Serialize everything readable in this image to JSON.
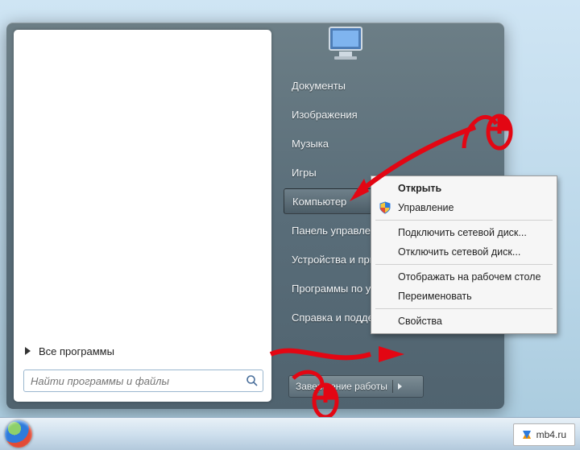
{
  "start_menu": {
    "all_programs_label": "Все программы",
    "search_placeholder": "Найти программы и файлы",
    "right_items": [
      {
        "label": "Документы",
        "selected": false
      },
      {
        "label": "Изображения",
        "selected": false
      },
      {
        "label": "Музыка",
        "selected": false
      },
      {
        "label": "Игры",
        "selected": false
      },
      {
        "label": "Компьютер",
        "selected": true
      },
      {
        "label": "Панель управления",
        "selected": false
      },
      {
        "label": "Устройства и принтеры",
        "selected": false
      },
      {
        "label": "Программы по умолчанию",
        "selected": false
      },
      {
        "label": "Справка и поддержка",
        "selected": false
      }
    ],
    "shutdown_label": "Завершение работы"
  },
  "context_menu": {
    "items": [
      {
        "label": "Открыть",
        "bold": true
      },
      {
        "label": "Управление",
        "icon": "shield"
      },
      {
        "sep": true
      },
      {
        "label": "Подключить сетевой диск..."
      },
      {
        "label": "Отключить сетевой диск..."
      },
      {
        "sep": true
      },
      {
        "label": "Отображать на рабочем столе"
      },
      {
        "label": "Переименовать"
      },
      {
        "sep": true
      },
      {
        "label": "Свойства"
      }
    ]
  },
  "tray": {
    "label": "mb4.ru"
  },
  "colors": {
    "annotation": "#e30613"
  }
}
